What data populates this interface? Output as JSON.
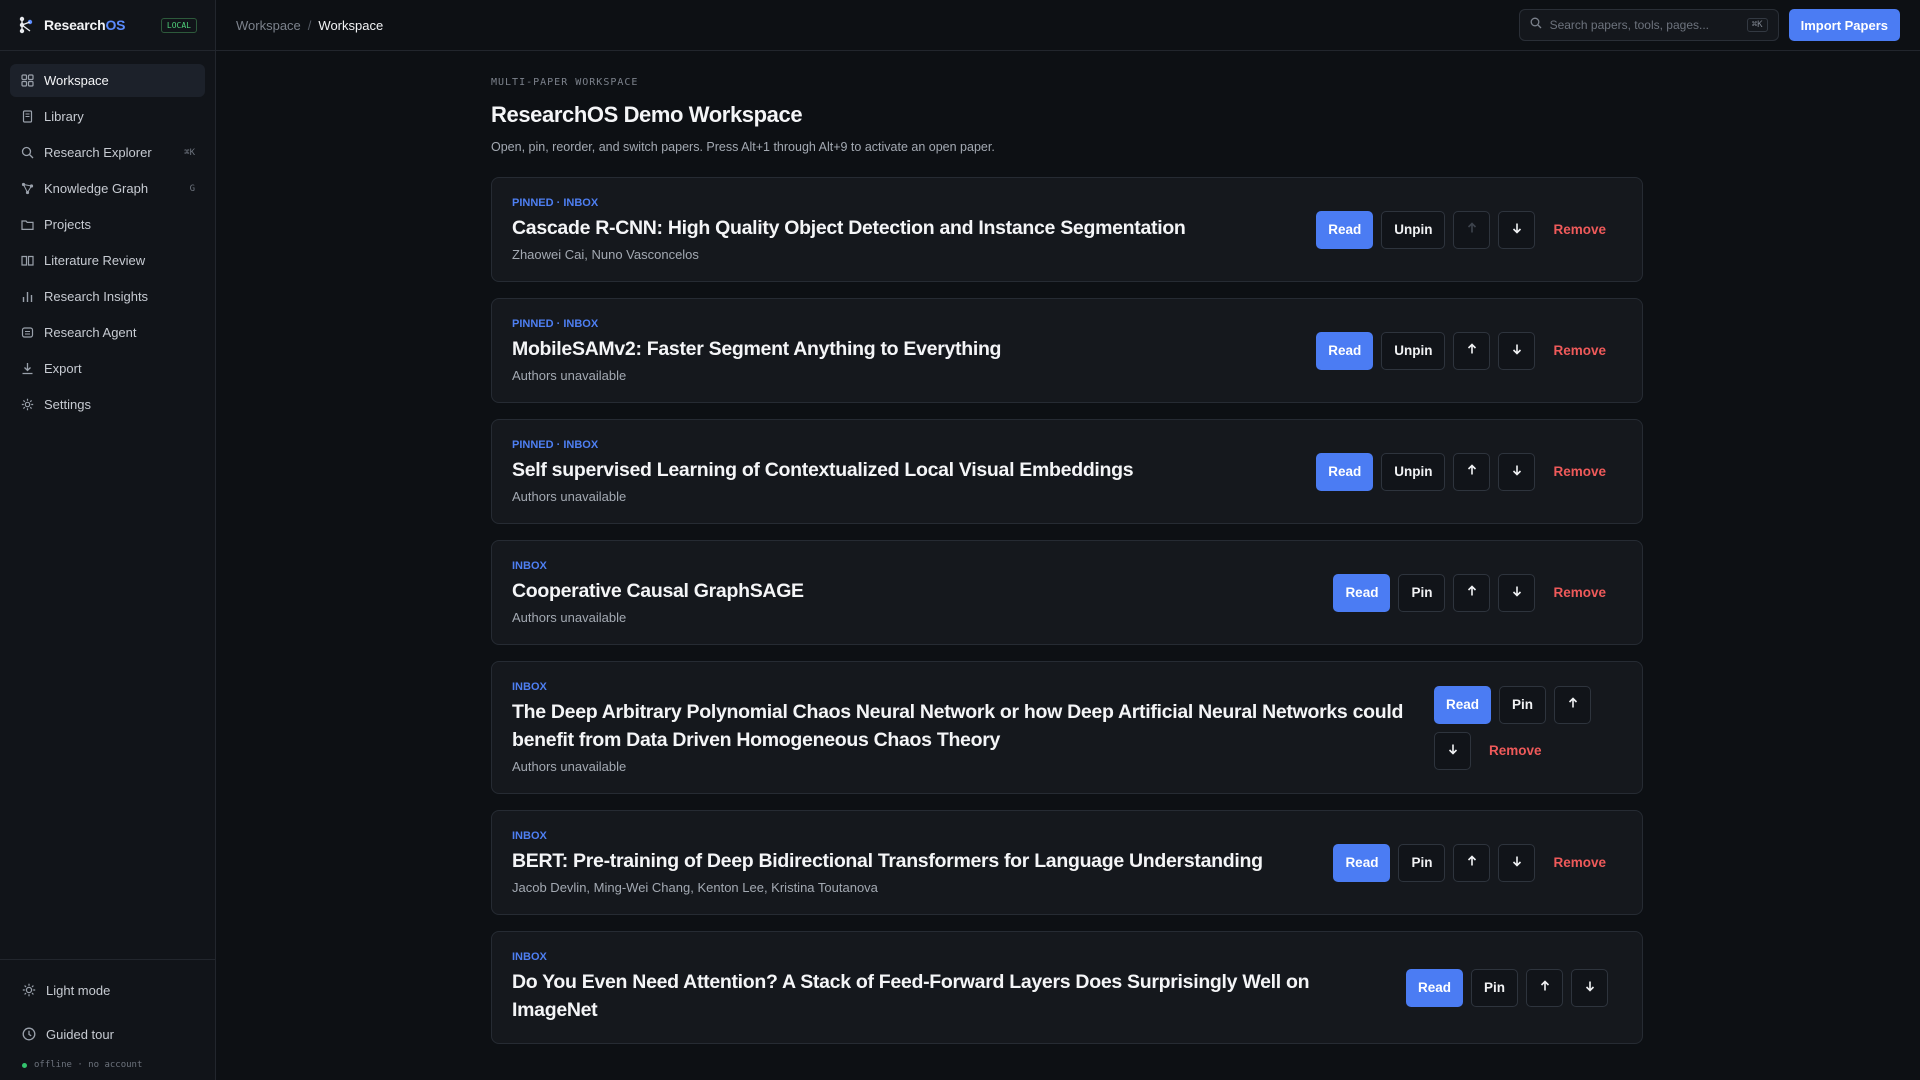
{
  "brand": {
    "name_main": "Research",
    "name_accent": "OS",
    "badge": "LOCAL"
  },
  "nav": [
    {
      "label": "Workspace",
      "icon": "grid-icon",
      "hint": "",
      "active": true
    },
    {
      "label": "Library",
      "icon": "book-icon",
      "hint": ""
    },
    {
      "label": "Research Explorer",
      "icon": "search-icon",
      "hint": "⌘K"
    },
    {
      "label": "Knowledge Graph",
      "icon": "graph-icon",
      "hint": "G"
    },
    {
      "label": "Projects",
      "icon": "folder-icon",
      "hint": ""
    },
    {
      "label": "Literature Review",
      "icon": "open-book-icon",
      "hint": ""
    },
    {
      "label": "Research Insights",
      "icon": "bar-chart-icon",
      "hint": ""
    },
    {
      "label": "Research Agent",
      "icon": "bot-icon",
      "hint": ""
    },
    {
      "label": "Export",
      "icon": "download-icon",
      "hint": ""
    },
    {
      "label": "Settings",
      "icon": "gear-icon",
      "hint": ""
    }
  ],
  "sidebar_bottom": {
    "light_mode": "Light mode",
    "guided_tour": "Guided tour",
    "status": "offline · no account"
  },
  "topbar": {
    "crumb_parent": "Workspace",
    "crumb_sep": "/",
    "crumb_current": "Workspace",
    "search_placeholder": "Search papers, tools, pages...",
    "search_shortcut": "⌘K",
    "import_label": "Import Papers"
  },
  "header": {
    "eyebrow": "MULTI-PAPER WORKSPACE",
    "title": "ResearchOS Demo Workspace",
    "description": "Open, pin, reorder, and switch papers. Press Alt+1 through Alt+9 to activate an open paper."
  },
  "actions": {
    "read": "Read",
    "pin": "Pin",
    "unpin": "Unpin",
    "remove": "Remove",
    "up_icon": "arrow-up-icon",
    "down_icon": "arrow-down-icon"
  },
  "papers": [
    {
      "tags": "PINNED · INBOX",
      "title": "Cascade R-CNN: High Quality Object Detection and Instance Segmentation",
      "authors": "Zhaowei Cai, Nuno Vasconcelos",
      "pinned": true,
      "up_disabled": true
    },
    {
      "tags": "PINNED · INBOX",
      "title": "MobileSAMv2: Faster Segment Anything to Everything",
      "authors": "Authors unavailable",
      "pinned": true
    },
    {
      "tags": "PINNED · INBOX",
      "title": "Self supervised Learning of Contextualized Local Visual Embeddings",
      "authors": "Authors unavailable",
      "pinned": true
    },
    {
      "tags": "INBOX",
      "title": "Cooperative Causal GraphSAGE",
      "authors": "Authors unavailable",
      "pinned": false
    },
    {
      "tags": "INBOX",
      "title": "The Deep Arbitrary Polynomial Chaos Neural Network or how Deep Artificial Neural Networks could benefit from Data Driven Homogeneous Chaos Theory",
      "authors": "Authors unavailable",
      "pinned": false,
      "wrap": true
    },
    {
      "tags": "INBOX",
      "title": "BERT: Pre-training of Deep Bidirectional Transformers for Language Understanding",
      "authors": "Jacob Devlin, Ming-Wei Chang, Kenton Lee, Kristina Toutanova",
      "pinned": false
    },
    {
      "tags": "INBOX",
      "title": "Do You Even Need Attention? A Stack of Feed-Forward Layers Does Surprisingly Well on ImageNet",
      "authors": "",
      "pinned": false,
      "partial": true
    }
  ]
}
